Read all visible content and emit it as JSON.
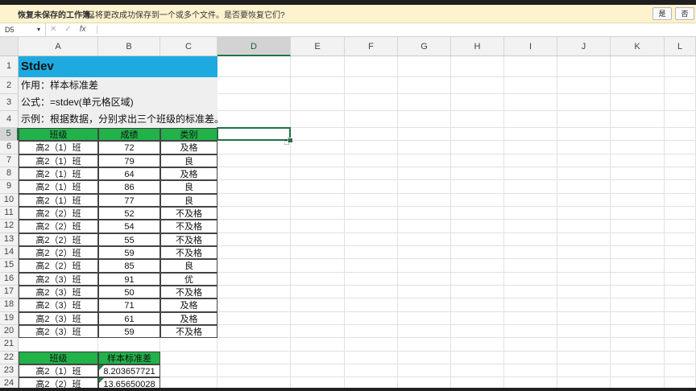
{
  "infobar": {
    "title": "恢复未保存的工作簿。",
    "message": "已将更改成功保存到一个或多个文件。是否要恢复它们?",
    "yes_label": "是",
    "no_label": "否"
  },
  "formula_bar": {
    "name_box": "D5",
    "cancel_icon": "✕",
    "enter_icon": "✓",
    "fx_label": "fx",
    "formula": ""
  },
  "columns": [
    "A",
    "B",
    "C",
    "D",
    "E",
    "F",
    "G",
    "H",
    "I",
    "J",
    "K",
    "L"
  ],
  "rows": [
    "1",
    "2",
    "3",
    "4",
    "5",
    "6",
    "7",
    "8",
    "9",
    "10",
    "11",
    "12",
    "13",
    "14",
    "15",
    "16",
    "17",
    "18",
    "19",
    "20",
    "21",
    "22",
    "23",
    "24"
  ],
  "sheet": {
    "title": "Stdev",
    "purpose": "作用：样本标准差",
    "formula_desc": "公式：=stdev(单元格区域)",
    "example": "示例：根据数据，分别求出三个班级的标准差。",
    "headers": [
      "班级",
      "成绩",
      "类别"
    ],
    "records": [
      [
        "高2（1）班",
        "72",
        "及格"
      ],
      [
        "高2（1）班",
        "79",
        "良"
      ],
      [
        "高2（1）班",
        "64",
        "及格"
      ],
      [
        "高2（1）班",
        "86",
        "良"
      ],
      [
        "高2（1）班",
        "77",
        "良"
      ],
      [
        "高2（2）班",
        "52",
        "不及格"
      ],
      [
        "高2（2）班",
        "54",
        "不及格"
      ],
      [
        "高2（2）班",
        "55",
        "不及格"
      ],
      [
        "高2（2）班",
        "59",
        "不及格"
      ],
      [
        "高2（2）班",
        "85",
        "良"
      ],
      [
        "高2（3）班",
        "91",
        "优"
      ],
      [
        "高2（3）班",
        "50",
        "不及格"
      ],
      [
        "高2（3）班",
        "71",
        "及格"
      ],
      [
        "高2（3）班",
        "61",
        "及格"
      ],
      [
        "高2（3）班",
        "59",
        "不及格"
      ]
    ],
    "summary_headers": [
      "班级",
      "样本标准差"
    ],
    "summary": [
      [
        "高2（1）班",
        "8.203657721"
      ],
      [
        "高2（2）班",
        "13.65650028"
      ]
    ]
  },
  "selected_cell": "D5",
  "colors": {
    "title_bg": "#1eaae0",
    "header_bg": "#21b24a",
    "desc_bg": "#efefef",
    "selection": "#217346",
    "infobar_bg": "#fdf3cf"
  }
}
